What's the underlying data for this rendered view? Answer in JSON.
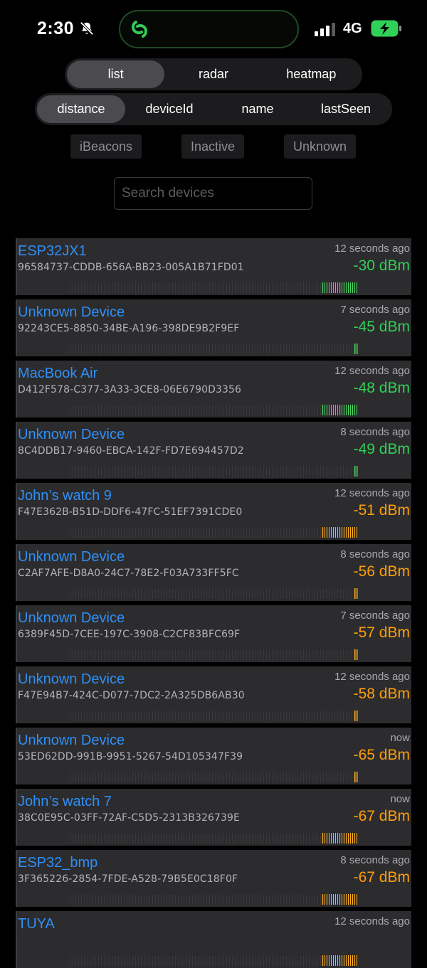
{
  "status_bar": {
    "time": "2:30",
    "network": "4G",
    "icons": [
      "bell-slash-icon",
      "app-link-icon",
      "cellular-signal-icon",
      "battery-charging-icon"
    ]
  },
  "view_tabs": [
    {
      "label": "list",
      "active": true
    },
    {
      "label": "radar",
      "active": false
    },
    {
      "label": "heatmap",
      "active": false
    }
  ],
  "sort_tabs": [
    {
      "label": "distance",
      "active": true
    },
    {
      "label": "deviceId",
      "active": false
    },
    {
      "label": "name",
      "active": false
    },
    {
      "label": "lastSeen",
      "active": false
    }
  ],
  "filters": [
    "iBeacons",
    "Inactive",
    "Unknown"
  ],
  "search": {
    "placeholder": "Search devices",
    "value": ""
  },
  "colors": {
    "accent": "#2f8ff7",
    "strong": "#30d158",
    "medium": "#ff9f0a",
    "signal_bar_green": "#4cd964",
    "signal_bar_orange": "#ffb020"
  },
  "devices": [
    {
      "name": "ESP32JX1",
      "id": "96584737-CDDB-656A-BB23-005A1B71FD01",
      "seen": "12 seconds ago",
      "rssi": "-30 dBm",
      "level": "strong",
      "activity": "wide"
    },
    {
      "name": "Unknown Device",
      "id": "92243CE5-8850-34BE-A196-398DE9B2F9EF",
      "seen": "7 seconds ago",
      "rssi": "-45 dBm",
      "level": "strong",
      "activity": "narrow"
    },
    {
      "name": "MacBook Air",
      "id": "D412F578-C377-3A33-3CE8-06E6790D3356",
      "seen": "12 seconds ago",
      "rssi": "-48 dBm",
      "level": "strong",
      "activity": "wide"
    },
    {
      "name": "Unknown Device",
      "id": "8C4DDB17-9460-EBCA-142F-FD7E694457D2",
      "seen": "8 seconds ago",
      "rssi": "-49 dBm",
      "level": "strong",
      "activity": "narrow"
    },
    {
      "name": "John’s watch 9",
      "id": "F47E362B-B51D-DDF6-47FC-51EF7391CDE0",
      "seen": "12 seconds ago",
      "rssi": "-51 dBm",
      "level": "medium",
      "activity": "wide"
    },
    {
      "name": "Unknown Device",
      "id": "C2AF7AFE-D8A0-24C7-78E2-F03A733FF5FC",
      "seen": "8 seconds ago",
      "rssi": "-56 dBm",
      "level": "medium",
      "activity": "narrow"
    },
    {
      "name": "Unknown Device",
      "id": "6389F45D-7CEE-197C-3908-C2CF83BFC69F",
      "seen": "7 seconds ago",
      "rssi": "-57 dBm",
      "level": "medium",
      "activity": "narrow"
    },
    {
      "name": "Unknown Device",
      "id": "F47E94B7-424C-D077-7DC2-2A325DB6AB30",
      "seen": "12 seconds ago",
      "rssi": "-58 dBm",
      "level": "medium",
      "activity": "narrow"
    },
    {
      "name": "Unknown Device",
      "id": "53ED62DD-991B-9951-5267-54D105347F39",
      "seen": "now",
      "rssi": "-65 dBm",
      "level": "medium",
      "activity": "narrow"
    },
    {
      "name": "John’s watch 7",
      "id": "38C0E95C-03FF-72AF-C5D5-2313B326739E",
      "seen": "now",
      "rssi": "-67 dBm",
      "level": "medium",
      "activity": "wide"
    },
    {
      "name": "ESP32_bmp",
      "id": "3F365226-2854-7FDE-A528-79B5E0C18F0F",
      "seen": "8 seconds ago",
      "rssi": "-67 dBm",
      "level": "medium",
      "activity": "wide"
    },
    {
      "name": "TUYA",
      "id": "",
      "seen": "12 seconds ago",
      "rssi": "",
      "level": "medium",
      "activity": "wide"
    }
  ]
}
